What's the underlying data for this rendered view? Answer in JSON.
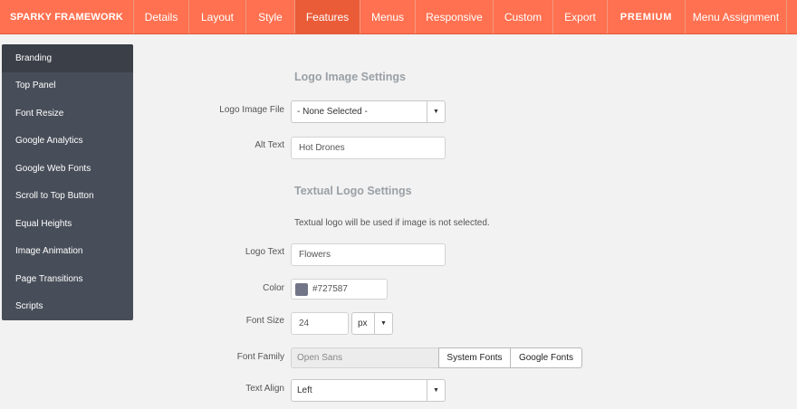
{
  "header": {
    "brand": "SPARKY FRAMEWORK",
    "tabs": [
      {
        "label": "Details"
      },
      {
        "label": "Layout"
      },
      {
        "label": "Style"
      },
      {
        "label": "Features"
      },
      {
        "label": "Menus"
      },
      {
        "label": "Responsive"
      },
      {
        "label": "Custom"
      },
      {
        "label": "Export"
      },
      {
        "label": "PREMIUM"
      },
      {
        "label": "Menu Assignment"
      }
    ],
    "active_tab": "Features",
    "accent_color": "#ff7150",
    "active_color": "#ea5b38"
  },
  "sidebar": {
    "items": [
      {
        "label": "Branding"
      },
      {
        "label": "Top Panel"
      },
      {
        "label": "Font Resize"
      },
      {
        "label": "Google Analytics"
      },
      {
        "label": "Google Web Fonts"
      },
      {
        "label": "Scroll to Top Button"
      },
      {
        "label": "Equal Heights"
      },
      {
        "label": "Image Animation"
      },
      {
        "label": "Page Transitions"
      },
      {
        "label": "Scripts"
      }
    ],
    "active_item": "Branding"
  },
  "logo_image": {
    "title": "Logo Image Settings",
    "file_label": "Logo Image File",
    "file_value": "- None Selected -",
    "alt_label": "Alt Text",
    "alt_value": "Hot Drones"
  },
  "text_logo": {
    "title": "Textual Logo Settings",
    "note": "Textual logo will be used if image is not selected.",
    "text_label": "Logo Text",
    "text_value": "Flowers",
    "color_label": "Color",
    "color_value": "#727587",
    "size_label": "Font Size",
    "size_value": "24",
    "size_unit": "px",
    "family_label": "Font Family",
    "family_value": "Open Sans",
    "system_fonts_label": "System Fonts",
    "google_fonts_label": "Google Fonts",
    "align_label": "Text Align",
    "align_value": "Left"
  },
  "icons": {
    "caret": "caret-down-icon"
  }
}
